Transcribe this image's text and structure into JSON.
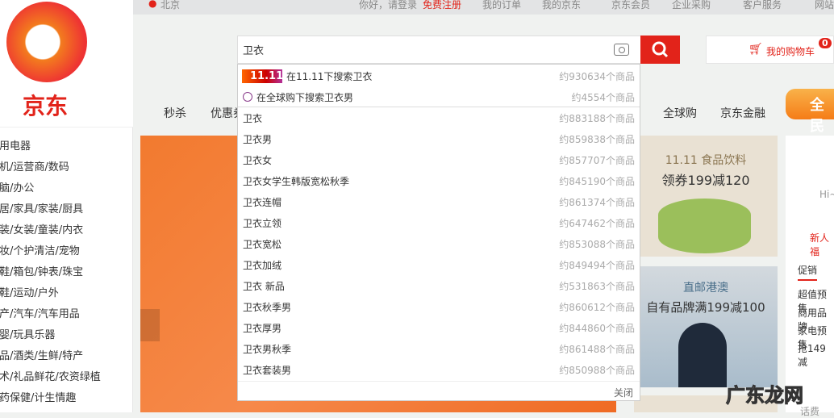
{
  "topbar": {
    "location": "北京",
    "greeting": "你好，请登录",
    "register": "免费注册",
    "links": [
      "我的订单",
      "我的京东",
      "京东会员",
      "企业采购",
      "客户服务",
      "网站"
    ]
  },
  "logo": {
    "text": "京东"
  },
  "categories": [
    "家用电器",
    "手机/运营商/数码",
    "电脑/办公",
    "家居/家具/家装/厨具",
    "男装/女装/童装/内衣",
    "美妆/个护清洁/宠物",
    "女鞋/箱包/钟表/珠宝",
    "男鞋/运动/户外",
    "房产/汽车/汽车用品",
    "母婴/玩具乐器",
    "食品/酒类/生鲜/特产",
    "艺术/礼品鲜花/农资绿植",
    "医药保健/计生情趣"
  ],
  "search": {
    "value": "卫衣"
  },
  "cart": {
    "label": "我的购物车",
    "count": "0"
  },
  "nav": [
    "秒杀",
    "优惠券",
    "全球购",
    "京东金融"
  ],
  "nav_badge": "全民",
  "suggest": {
    "special": [
      {
        "badge": "11.11",
        "text": "在11.11下搜索卫衣",
        "count": "约930634个商品"
      },
      {
        "text": "在全球购下搜索卫衣男",
        "count": "约4554个商品"
      }
    ],
    "items": [
      {
        "text": "卫衣",
        "count": "约883188个商品"
      },
      {
        "text": "卫衣男",
        "count": "约859838个商品"
      },
      {
        "text": "卫衣女",
        "count": "约857707个商品"
      },
      {
        "text": "卫衣女学生韩版宽松秋季",
        "count": "约845190个商品"
      },
      {
        "text": "卫衣连帽",
        "count": "约861374个商品"
      },
      {
        "text": "卫衣立领",
        "count": "约647462个商品"
      },
      {
        "text": "卫衣宽松",
        "count": "约853088个商品"
      },
      {
        "text": "卫衣加绒",
        "count": "约849494个商品"
      },
      {
        "text": "卫衣 新品",
        "count": "约531863个商品"
      },
      {
        "text": "卫衣秋季男",
        "count": "约860612个商品"
      },
      {
        "text": "卫衣厚男",
        "count": "约844860个商品"
      },
      {
        "text": "卫衣男秋季",
        "count": "约861488个商品"
      },
      {
        "text": "卫衣套装男",
        "count": "约850988个商品"
      }
    ],
    "close": "关闭"
  },
  "promo1": {
    "title": "11.11 食品饮料",
    "sub": "领券199减120"
  },
  "promo2": {
    "title": "直邮港澳",
    "sub": "自有品牌满199减100"
  },
  "user": {
    "hi": "Hi~",
    "newuser": "新人福",
    "tab": "促销",
    "news": [
      "超值预售",
      "商用品牌",
      "家电预售",
      "抢149减"
    ],
    "fee": "话费"
  },
  "watermark": "广东龙网"
}
